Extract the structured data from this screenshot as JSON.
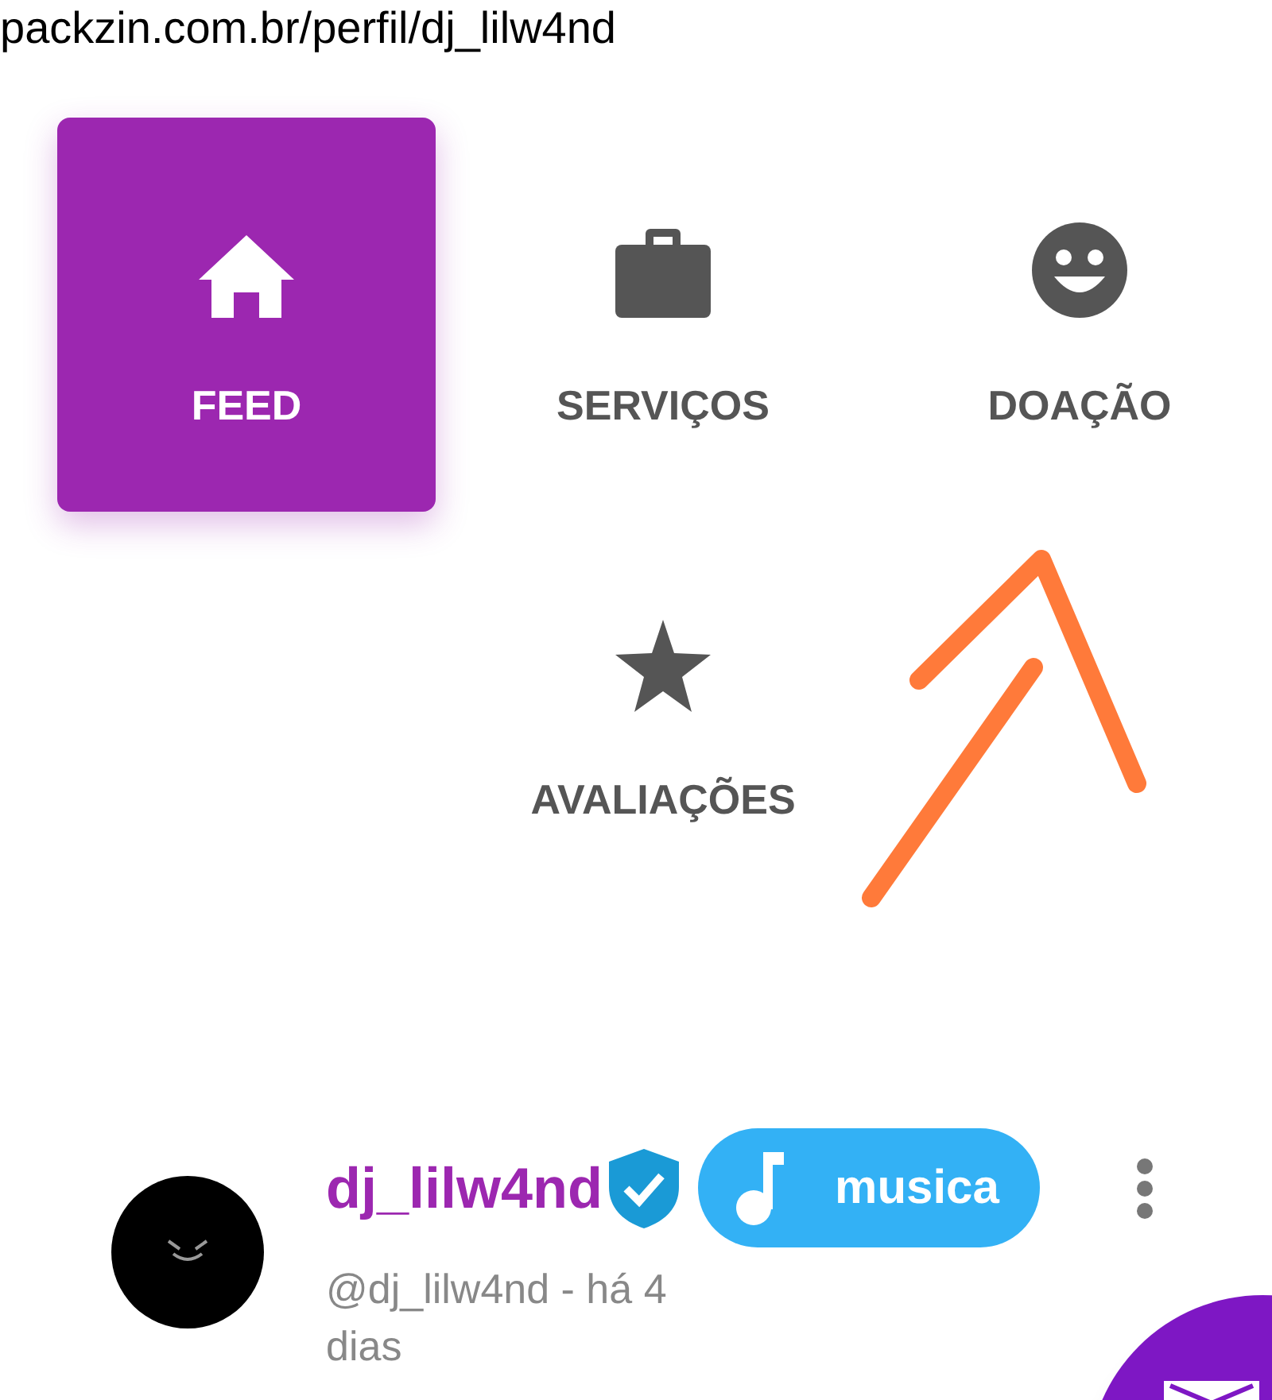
{
  "url": "packzin.com.br/perfil/dj_lilw4nd",
  "tabs": [
    {
      "label": "FEED",
      "selected": true
    },
    {
      "label": "SERVIÇOS",
      "selected": false
    },
    {
      "label": "DOAÇÃO",
      "selected": false
    },
    {
      "label": "AVALIAÇÕES",
      "selected": false
    }
  ],
  "post": {
    "name": "dj_lilw4nd",
    "verified": true,
    "tag": "musica",
    "meta": "@dj_lilw4nd - há 4 dias"
  }
}
